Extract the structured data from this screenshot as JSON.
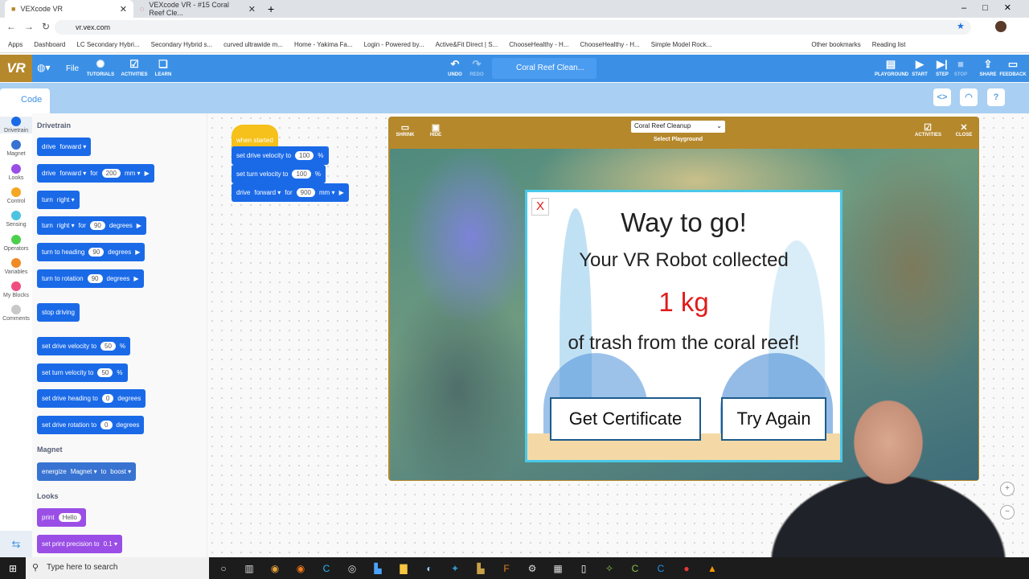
{
  "browser": {
    "tabs": [
      {
        "title": "VEXcode VR"
      },
      {
        "title": "VEXcode VR - #15 Coral Reef Cle..."
      }
    ],
    "url": "vr.vex.com",
    "bookmarks": [
      "Apps",
      "Dashboard",
      "LC Secondary Hybri...",
      "Secondary Hybrid s...",
      "curved ultrawide m...",
      "Home - Yakima Fa...",
      "Login - Powered by...",
      "Active&Fit Direct | S...",
      "ChooseHealthy - H...",
      "ChooseHealthy - H...",
      "Simple Model Rock..."
    ],
    "other_bookmarks": "Other bookmarks",
    "reading_list": "Reading list"
  },
  "toolbar": {
    "logo": "VR",
    "file": "File",
    "tutorials": "TUTORIALS",
    "activities": "ACTIVITIES",
    "learn": "LEARN",
    "undo": "UNDO",
    "redo": "REDO",
    "project_name": "Coral Reef Clean...",
    "playground": "PLAYGROUND",
    "start": "START",
    "step": "STEP",
    "stop": "STOP",
    "share": "SHARE",
    "feedback": "FEEDBACK",
    "brand_color": "#3b90e6",
    "logo_color": "#b5882c"
  },
  "code_tab": "Code",
  "categories": [
    {
      "label": "Drivetrain",
      "color": "#1a6ae8"
    },
    {
      "label": "Magnet",
      "color": "#3873d2"
    },
    {
      "label": "Looks",
      "color": "#9a4ee6"
    },
    {
      "label": "Control",
      "color": "#f5a623"
    },
    {
      "label": "Sensing",
      "color": "#4cc4e0"
    },
    {
      "label": "Operators",
      "color": "#4cd04c"
    },
    {
      "label": "Variables",
      "color": "#f08a24"
    },
    {
      "label": "My Blocks",
      "color": "#ef4f7f"
    },
    {
      "label": "Comments",
      "color": "#c8c8c8"
    }
  ],
  "palette": {
    "drivetrain": "Drivetrain",
    "magnet": "Magnet",
    "looks": "Looks",
    "b": {
      "drive": "drive",
      "forward": "forward",
      "for": "for",
      "v200": "200",
      "mm": "mm",
      "turn": "turn",
      "right": "right",
      "v90": "90",
      "degrees": "degrees",
      "turn_heading": "turn to heading",
      "turn_rotation": "turn to rotation",
      "stop": "stop driving",
      "sdv": "set drive velocity to",
      "v50": "50",
      "pct": "%",
      "stv": "set turn velocity to",
      "sdh": "set drive heading to",
      "v0": "0",
      "sdr": "set drive rotation to",
      "energize": "energize",
      "magnet": "Magnet",
      "to": "to",
      "boost": "boost",
      "print": "print",
      "hello": "Hello",
      "precision": "set print precision to",
      "p01": "0.1"
    }
  },
  "workspace": {
    "hat": "when started",
    "sdv": "set drive velocity to",
    "v1": "100",
    "stv": "set turn velocity to",
    "v2": "100",
    "drive": "drive",
    "forward": "forward",
    "for": "for",
    "dist": "900",
    "mm": "mm",
    "pct": "%"
  },
  "playground": {
    "shrink": "SHRINK",
    "hide": "HIDE",
    "selected": "Coral Reef Cleanup",
    "select_label": "Select Playground",
    "activities": "ACTIVITIES",
    "close": "CLOSE"
  },
  "dialog": {
    "close": "X",
    "title": "Way to go!",
    "line1": "Your VR Robot collected",
    "amount": "1 kg",
    "line2": "of trash from the coral reef!",
    "certificate": "Get Certificate",
    "try_again": "Try Again",
    "accent": "#49c8e8",
    "amount_color": "#e01b1b"
  },
  "taskbar": {
    "search": "Type here to search"
  }
}
